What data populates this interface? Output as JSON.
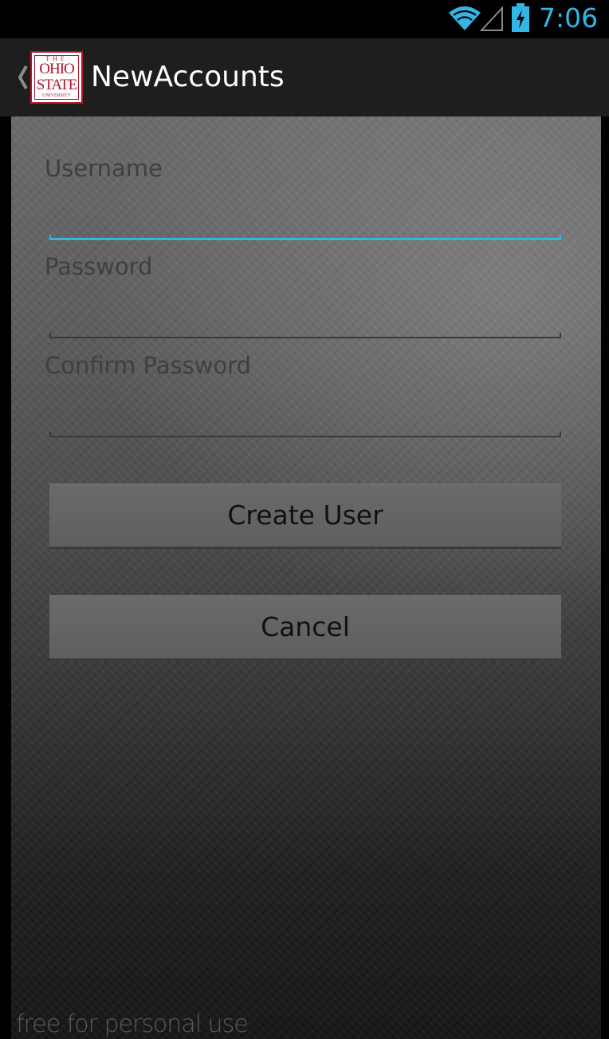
{
  "status_bar": {
    "time": "7:06",
    "icons": [
      "wifi-icon",
      "cell-signal-icon",
      "battery-charging-icon"
    ],
    "accent_color": "#33b5e5"
  },
  "action_bar": {
    "title": "NewAccounts",
    "logo": {
      "name": "ohio-state-university-logo",
      "line1": "THE",
      "line2": "OHIO",
      "line3": "STATE",
      "line4": "UNIVERSITY",
      "color": "#b0142b"
    },
    "up_icon": "chevron-left-icon"
  },
  "form": {
    "username": {
      "label": "Username",
      "value": "",
      "focused": true
    },
    "password": {
      "label": "Password",
      "value": ""
    },
    "confirm_password": {
      "label": "Confirm Password",
      "value": ""
    },
    "create_button": "Create User",
    "cancel_button": "Cancel"
  },
  "watermark": "free for personal use"
}
